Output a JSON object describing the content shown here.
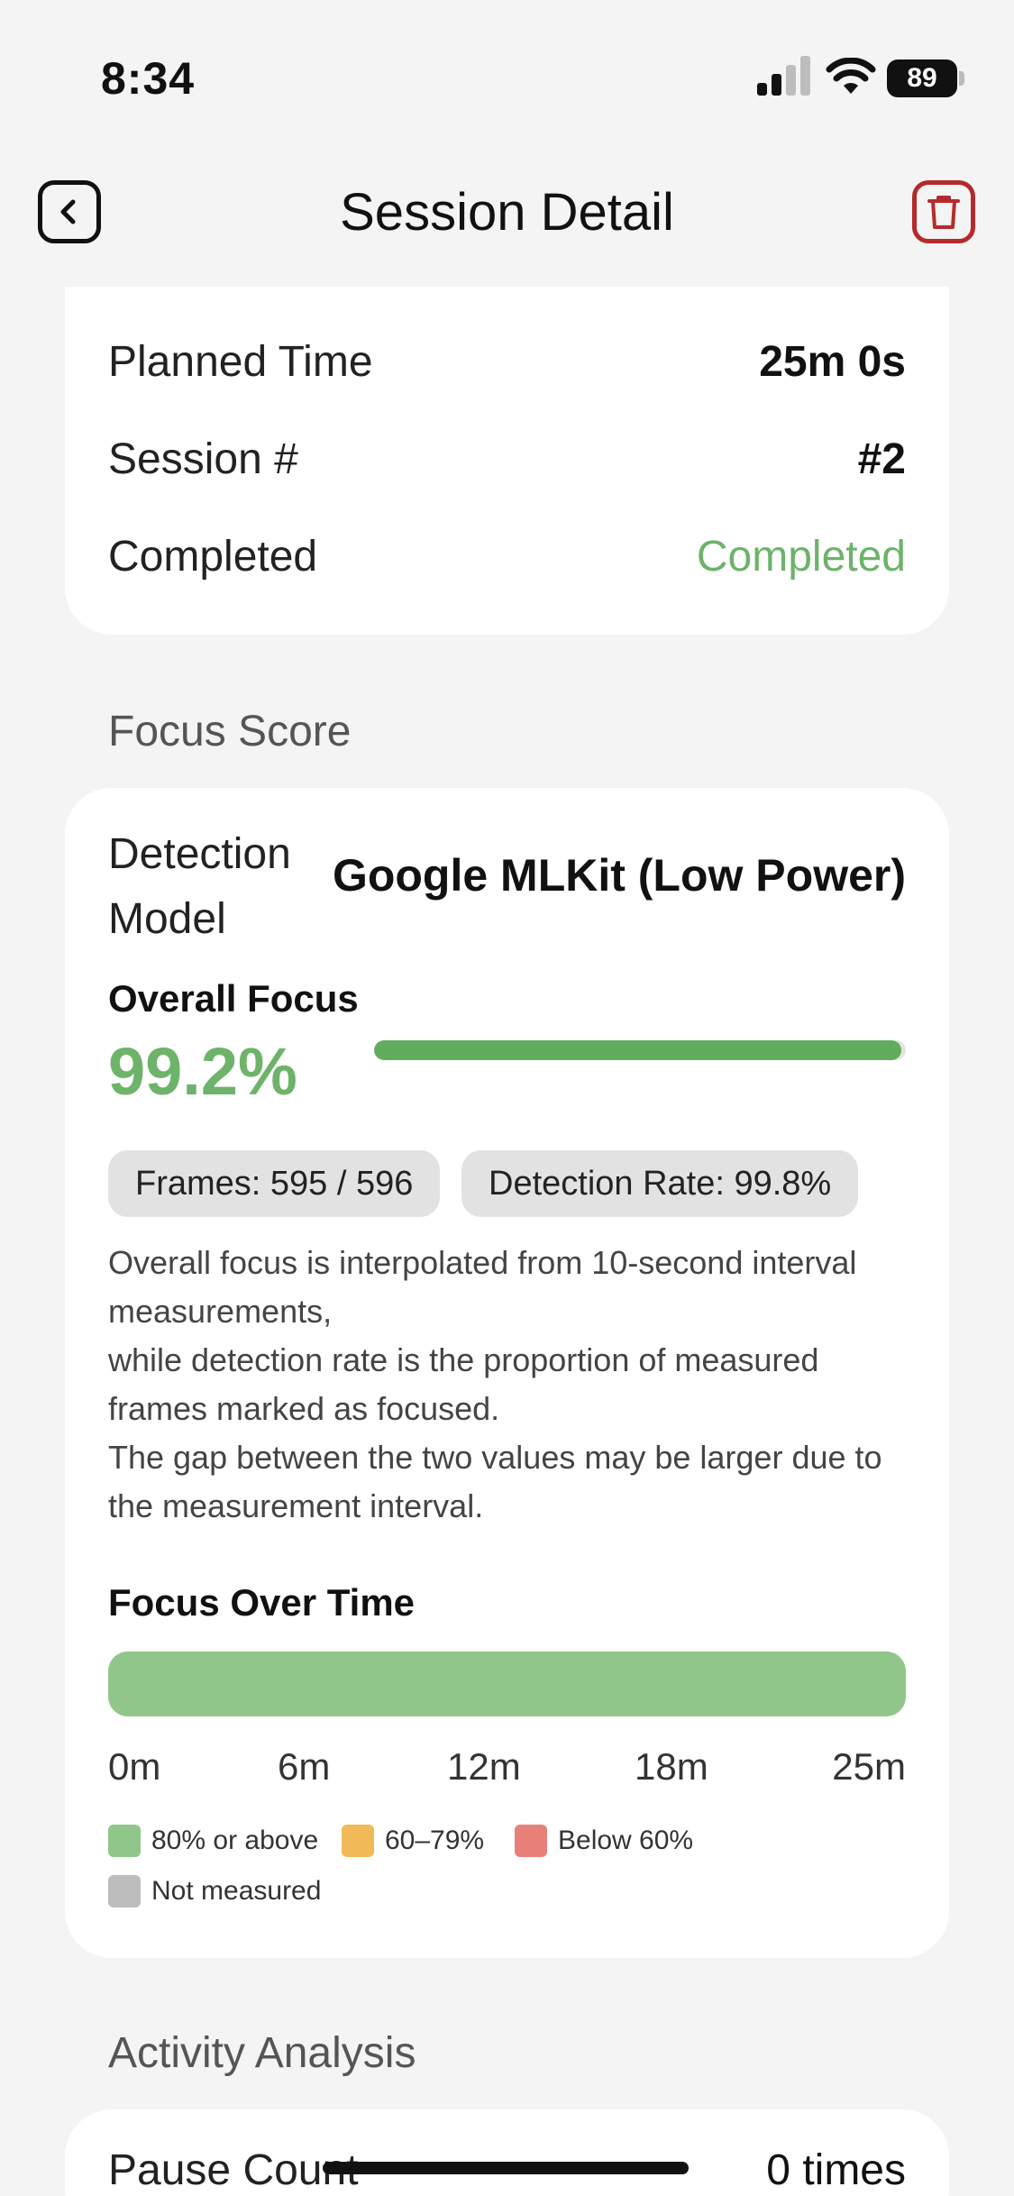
{
  "status_bar": {
    "time": "8:34",
    "battery": "89"
  },
  "nav": {
    "title": "Session Detail",
    "back_icon": "chevron-left-icon",
    "trash_icon": "trash-icon"
  },
  "summary": {
    "rows": [
      {
        "label": "Planned Time",
        "value": "25m 0s"
      },
      {
        "label": "Session #",
        "value": "#2"
      },
      {
        "label": "Completed",
        "value": "Completed",
        "value_color": "#6db36a"
      }
    ]
  },
  "focus_score": {
    "section_title": "Focus Score",
    "detection_label": "Detection Model",
    "detection_value": "Google MLKit (Low Power)",
    "overall_label": "Overall Focus",
    "overall_value": "99.2%",
    "overall_fraction": 0.992,
    "frames_chip": "Frames: 595 / 596",
    "detection_rate_chip": "Detection Rate: 99.8%",
    "note_lines": [
      "Overall focus is interpolated from 10-second interval measurements,",
      "while detection rate is the proportion of measured frames marked as focused.",
      "The gap between the two values may be larger due to the measurement interval."
    ],
    "timeline_title": "Focus Over Time",
    "timeline_segments": [
      {
        "start_min": 0,
        "end_min": 25,
        "category": "80% or above"
      }
    ],
    "timeline_total_min": 25,
    "ticks": [
      "0m",
      "6m",
      "12m",
      "18m",
      "25m"
    ],
    "legend": [
      {
        "label": "80% or above",
        "color": "#90c68a"
      },
      {
        "label": "60–79%",
        "color": "#f2b957"
      },
      {
        "label": "Below 60%",
        "color": "#e8807a"
      },
      {
        "label": "Not measured",
        "color": "#bdbdbd"
      }
    ]
  },
  "activity": {
    "section_title": "Activity Analysis",
    "pause_label": "Pause Count",
    "pause_value": "0 times"
  },
  "colors": {
    "accent_green": "#6db36a",
    "danger_red": "#b52a2a"
  }
}
